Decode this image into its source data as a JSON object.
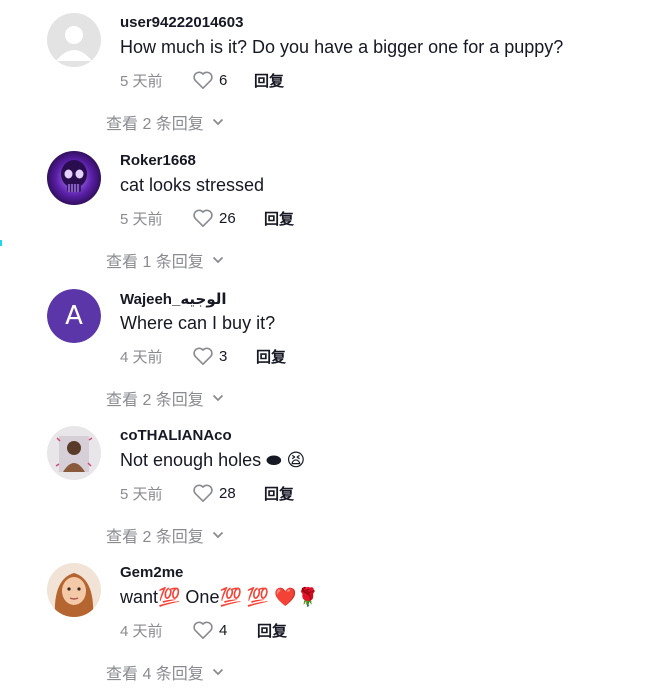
{
  "comments": [
    {
      "username": "user94222014603",
      "text": "How much is it? Do you have a bigger one for a puppy?",
      "time": "5 天前",
      "likes": "6",
      "reply": "回复",
      "view_replies": "查看 2 条回复",
      "avatar_icon": "default-user-avatar"
    },
    {
      "username": "Roker1668",
      "text": "cat looks stressed",
      "time": "5 天前",
      "likes": "26",
      "reply": "回复",
      "view_replies": "查看 1 条回复",
      "avatar_icon": "purple-skull-avatar"
    },
    {
      "username": "Wajeeh_الوجيه",
      "text": "Where can I buy it?",
      "time": "4 天前",
      "likes": "3",
      "reply": "回复",
      "view_replies": "查看 2 条回复",
      "avatar_letter": "A"
    },
    {
      "username": "coTHALIANAco",
      "text": "Not enough holes ⬬ 😫",
      "time": "5 天前",
      "likes": "28",
      "reply": "回复",
      "view_replies": "查看 2 条回复",
      "avatar_icon": "photo-avatar"
    },
    {
      "username": "Gem2me",
      "text": "want💯 One💯 💯 ❤️🌹",
      "time": "4 天前",
      "likes": "4",
      "reply": "回复",
      "view_replies": "查看 4 条回复",
      "avatar_icon": "photo-avatar"
    }
  ],
  "colors": {
    "primary_text": "#161823",
    "secondary_text": "#8a8b91",
    "letter_avatar_bg": "#5b36a8"
  }
}
